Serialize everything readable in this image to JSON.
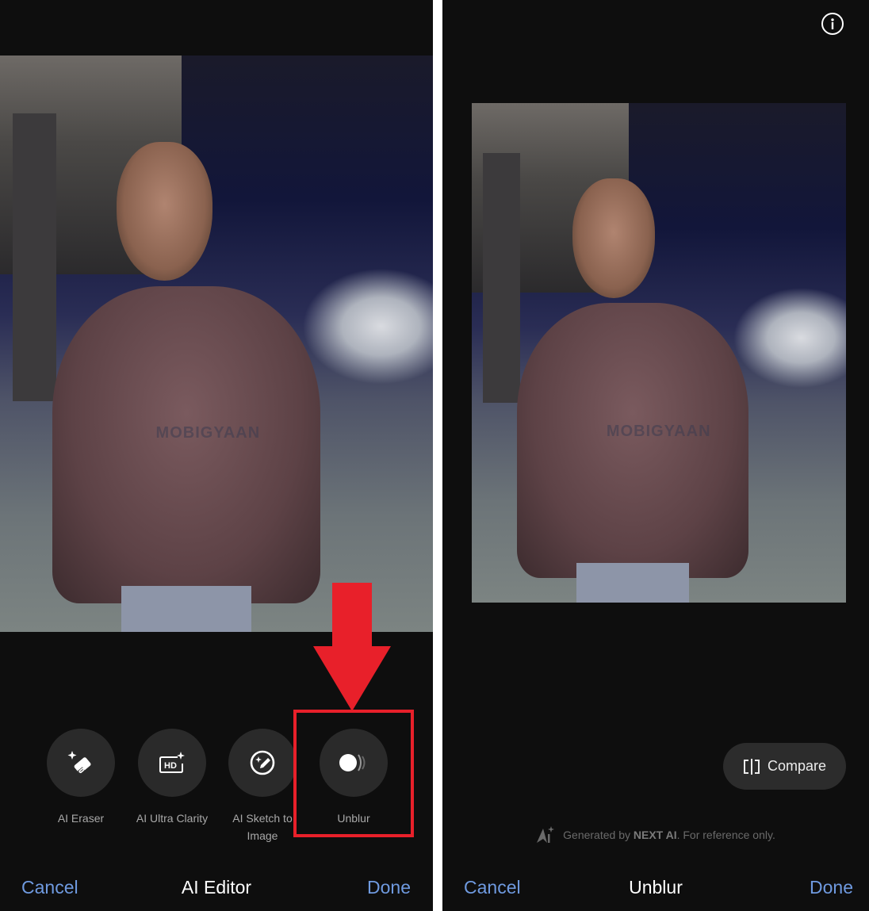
{
  "left_screen": {
    "watermark": "MOBIGYAAN",
    "tools": [
      {
        "label": "AI Eraser",
        "icon": "eraser-sparkle-icon"
      },
      {
        "label": "AI Ultra Clarity",
        "icon": "hd-sparkle-icon"
      },
      {
        "label": "AI Sketch to Image",
        "icon": "sketch-pencil-icon"
      },
      {
        "label": "Unblur",
        "icon": "unblur-icon"
      }
    ],
    "highlighted_tool": "Unblur",
    "annotation_color": "#e8202a",
    "bottom_bar": {
      "cancel": "Cancel",
      "title": "AI Editor",
      "done": "Done"
    }
  },
  "right_screen": {
    "watermark": "MOBIGYAAN",
    "info_icon": "info-icon",
    "compare_label": "Compare",
    "ai_note": {
      "prefix": "Generated by ",
      "brand": "NEXT AI",
      "suffix": ". For reference only."
    },
    "bottom_bar": {
      "cancel": "Cancel",
      "title": "Unblur",
      "done": "Done"
    }
  },
  "colors": {
    "accent_blue": "#6f9ae0",
    "background": "#0e0e0e",
    "button_bg": "#2a2a2a"
  }
}
